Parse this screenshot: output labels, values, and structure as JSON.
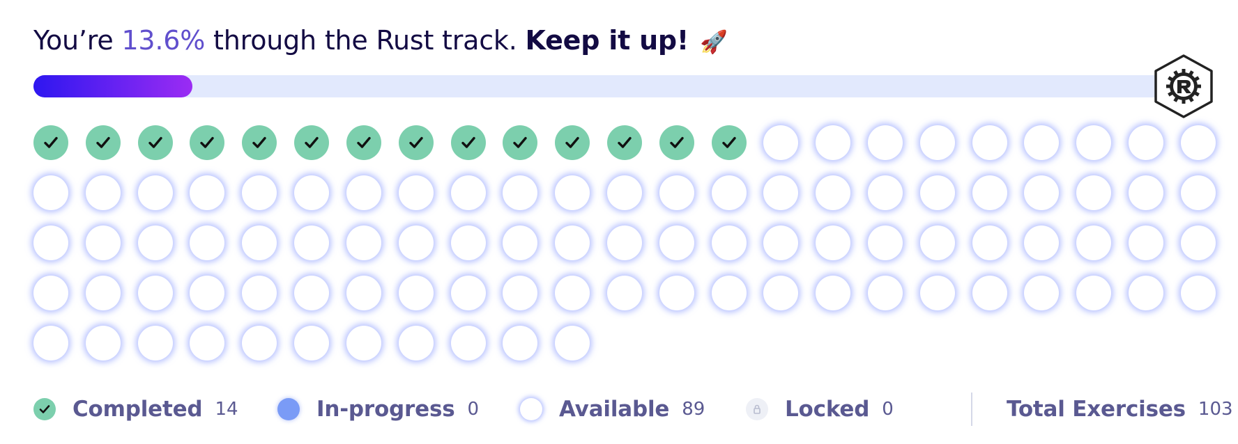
{
  "headline": {
    "prefix": "You’re ",
    "percent": "13.6%",
    "middle": " through the Rust track. ",
    "cheer": "Keep it up!",
    "emoji": "🚀"
  },
  "progress": {
    "fraction": 0.136
  },
  "track": {
    "icon": "rust-logo-icon"
  },
  "exercises": {
    "completed": 14,
    "in_progress": 0,
    "available": 89,
    "locked": 0,
    "total": 103
  },
  "legend": {
    "completed_label": "Completed",
    "completed_count": "14",
    "in_progress_label": "In-progress",
    "in_progress_count": "0",
    "available_label": "Available",
    "available_count": "89",
    "locked_label": "Locked",
    "locked_count": "0",
    "total_label": "Total Exercises",
    "total_count": "103"
  },
  "colors": {
    "completed": "#7ccfad",
    "in_progress": "#7a9bf6",
    "available_glow": "#8a9cff",
    "percent_accent": "#604fcd",
    "progress_start": "#2e17f0",
    "progress_end": "#9b2cf3",
    "track_bg": "#e2e9fd",
    "legend_text": "#5a5991",
    "headline_text": "#130b43"
  }
}
